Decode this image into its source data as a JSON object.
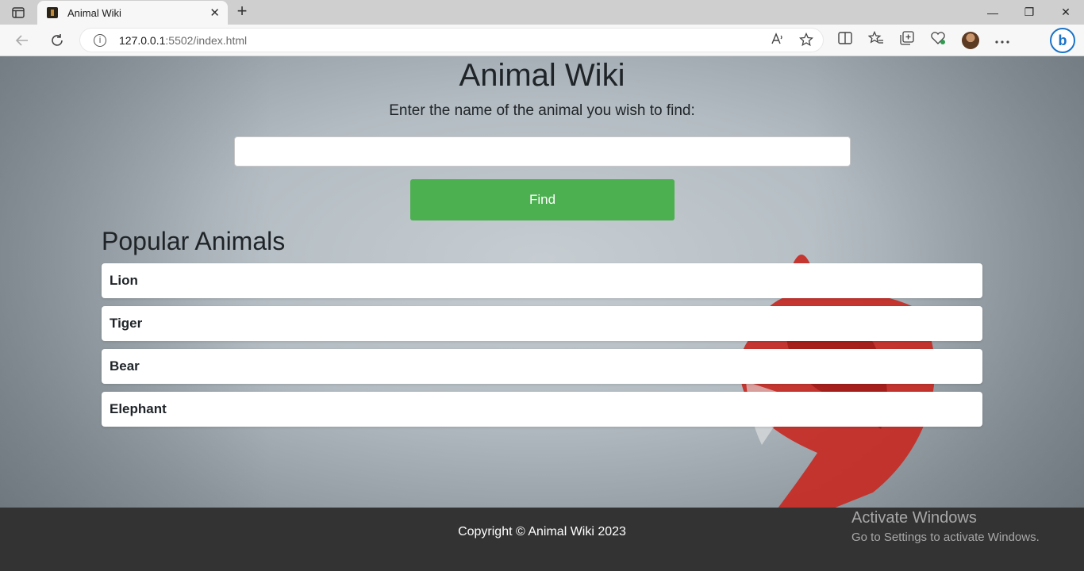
{
  "browser": {
    "tab_title": "Animal Wiki",
    "tab_close": "✕",
    "new_tab": "+",
    "url_host": "127.0.0.1",
    "url_rest": ":5502/index.html",
    "window_controls": [
      "—",
      "❐",
      "✕"
    ]
  },
  "page": {
    "title": "Animal Wiki",
    "prompt": "Enter the name of the animal you wish to find:",
    "search_value": "",
    "find_label": "Find",
    "popular_heading": "Popular Animals",
    "animals": [
      "Lion",
      "Tiger",
      "Bear",
      "Elephant"
    ]
  },
  "footer": {
    "copyright": "Copyright © Animal Wiki 2023"
  },
  "watermark": {
    "line1": "Activate Windows",
    "line2": "Go to Settings to activate Windows."
  },
  "colors": {
    "find_button": "#4caf50",
    "footer_bg": "#333333",
    "accent": "#1a73c8"
  }
}
